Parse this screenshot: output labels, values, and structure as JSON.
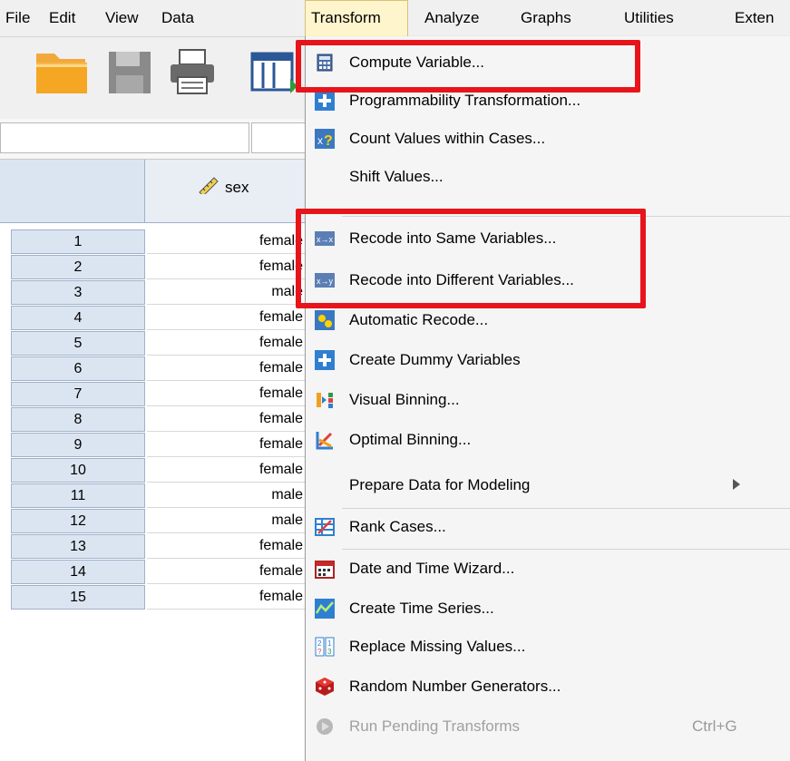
{
  "menubar": {
    "items": [
      {
        "label": "File"
      },
      {
        "label": "Edit"
      },
      {
        "label": "View"
      },
      {
        "label": "Data"
      },
      {
        "label": "Transform"
      },
      {
        "label": "Analyze"
      },
      {
        "label": "Graphs"
      },
      {
        "label": "Utilities"
      },
      {
        "label": "Exten"
      }
    ]
  },
  "grid": {
    "column_header": "sex",
    "rows": [
      {
        "num": "1",
        "value": "female"
      },
      {
        "num": "2",
        "value": "female"
      },
      {
        "num": "3",
        "value": "male"
      },
      {
        "num": "4",
        "value": "female"
      },
      {
        "num": "5",
        "value": "female"
      },
      {
        "num": "6",
        "value": "female"
      },
      {
        "num": "7",
        "value": "female"
      },
      {
        "num": "8",
        "value": "female"
      },
      {
        "num": "9",
        "value": "female"
      },
      {
        "num": "10",
        "value": "female"
      },
      {
        "num": "11",
        "value": "male"
      },
      {
        "num": "12",
        "value": "male"
      },
      {
        "num": "13",
        "value": "female"
      },
      {
        "num": "14",
        "value": "female"
      },
      {
        "num": "15",
        "value": "female"
      }
    ]
  },
  "transform_menu": {
    "items": [
      {
        "label": "Compute Variable...",
        "icon": "calculator-icon"
      },
      {
        "label": "Programmability Transformation...",
        "icon": "plus-icon"
      },
      {
        "label": "Count Values within Cases...",
        "icon": "count-values-icon"
      },
      {
        "label": "Shift Values..."
      },
      {
        "label": "Recode into Same Variables...",
        "icon": "recode-same-icon"
      },
      {
        "label": "Recode into Different Variables...",
        "icon": "recode-different-icon"
      },
      {
        "label": "Automatic Recode...",
        "icon": "automatic-recode-icon"
      },
      {
        "label": "Create Dummy Variables",
        "icon": "plus-icon"
      },
      {
        "label": "Visual Binning...",
        "icon": "visual-binning-icon"
      },
      {
        "label": "Optimal Binning...",
        "icon": "optimal-binning-icon"
      },
      {
        "label": "Prepare Data for Modeling"
      },
      {
        "label": "Rank Cases...",
        "icon": "rank-cases-icon"
      },
      {
        "label": "Date and Time Wizard...",
        "icon": "calendar-icon"
      },
      {
        "label": "Create Time Series...",
        "icon": "time-series-icon"
      },
      {
        "label": "Replace Missing Values...",
        "icon": "replace-missing-icon"
      },
      {
        "label": "Random Number Generators...",
        "icon": "dice-icon"
      },
      {
        "label": "Run Pending Transforms",
        "icon": "run-pending-icon",
        "shortcut": "Ctrl+G",
        "disabled": true
      }
    ]
  },
  "colors": {
    "highlight": "#e8141b",
    "menu_active": "#fff5cc",
    "row_header": "#dbe5f1"
  }
}
